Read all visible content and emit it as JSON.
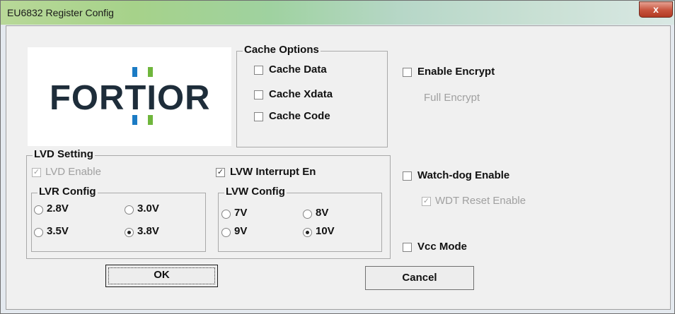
{
  "window": {
    "title": "EU6832 Register Config",
    "close_glyph": "x"
  },
  "logo": {
    "text": "FORTIOR",
    "colors": {
      "blue": "#1b7bc4",
      "green": "#6fb63c",
      "text": "#1e2d3a"
    }
  },
  "cache_options": {
    "title": "Cache Options",
    "items": [
      {
        "label": "Cache Data",
        "checked": false
      },
      {
        "label": "Cache Xdata",
        "checked": false
      },
      {
        "label": "Cache Code",
        "checked": false
      }
    ]
  },
  "encrypt": {
    "enable_label": "Enable Encrypt",
    "enable_checked": false,
    "full_label": "Full Encrypt"
  },
  "lvd": {
    "title": "LVD Setting",
    "enable_label": "LVD Enable",
    "enable_checked": true,
    "lvw_interrupt_label": "LVW Interrupt En",
    "lvw_interrupt_checked": true,
    "lvr": {
      "title": "LVR Config",
      "options": [
        "2.8V",
        "3.0V",
        "3.5V",
        "3.8V"
      ],
      "selected": "3.8V"
    },
    "lvw": {
      "title": "LVW Config",
      "options": [
        "7V",
        "8V",
        "9V",
        "10V"
      ],
      "selected": "10V"
    }
  },
  "watchdog": {
    "enable_label": "Watch-dog Enable",
    "enable_checked": false,
    "wdt_reset_label": "WDT Reset Enable",
    "wdt_reset_checked": true
  },
  "vcc": {
    "label": "Vcc Mode",
    "checked": false
  },
  "buttons": {
    "ok": "OK",
    "cancel": "Cancel"
  },
  "check_glyph": "✓"
}
